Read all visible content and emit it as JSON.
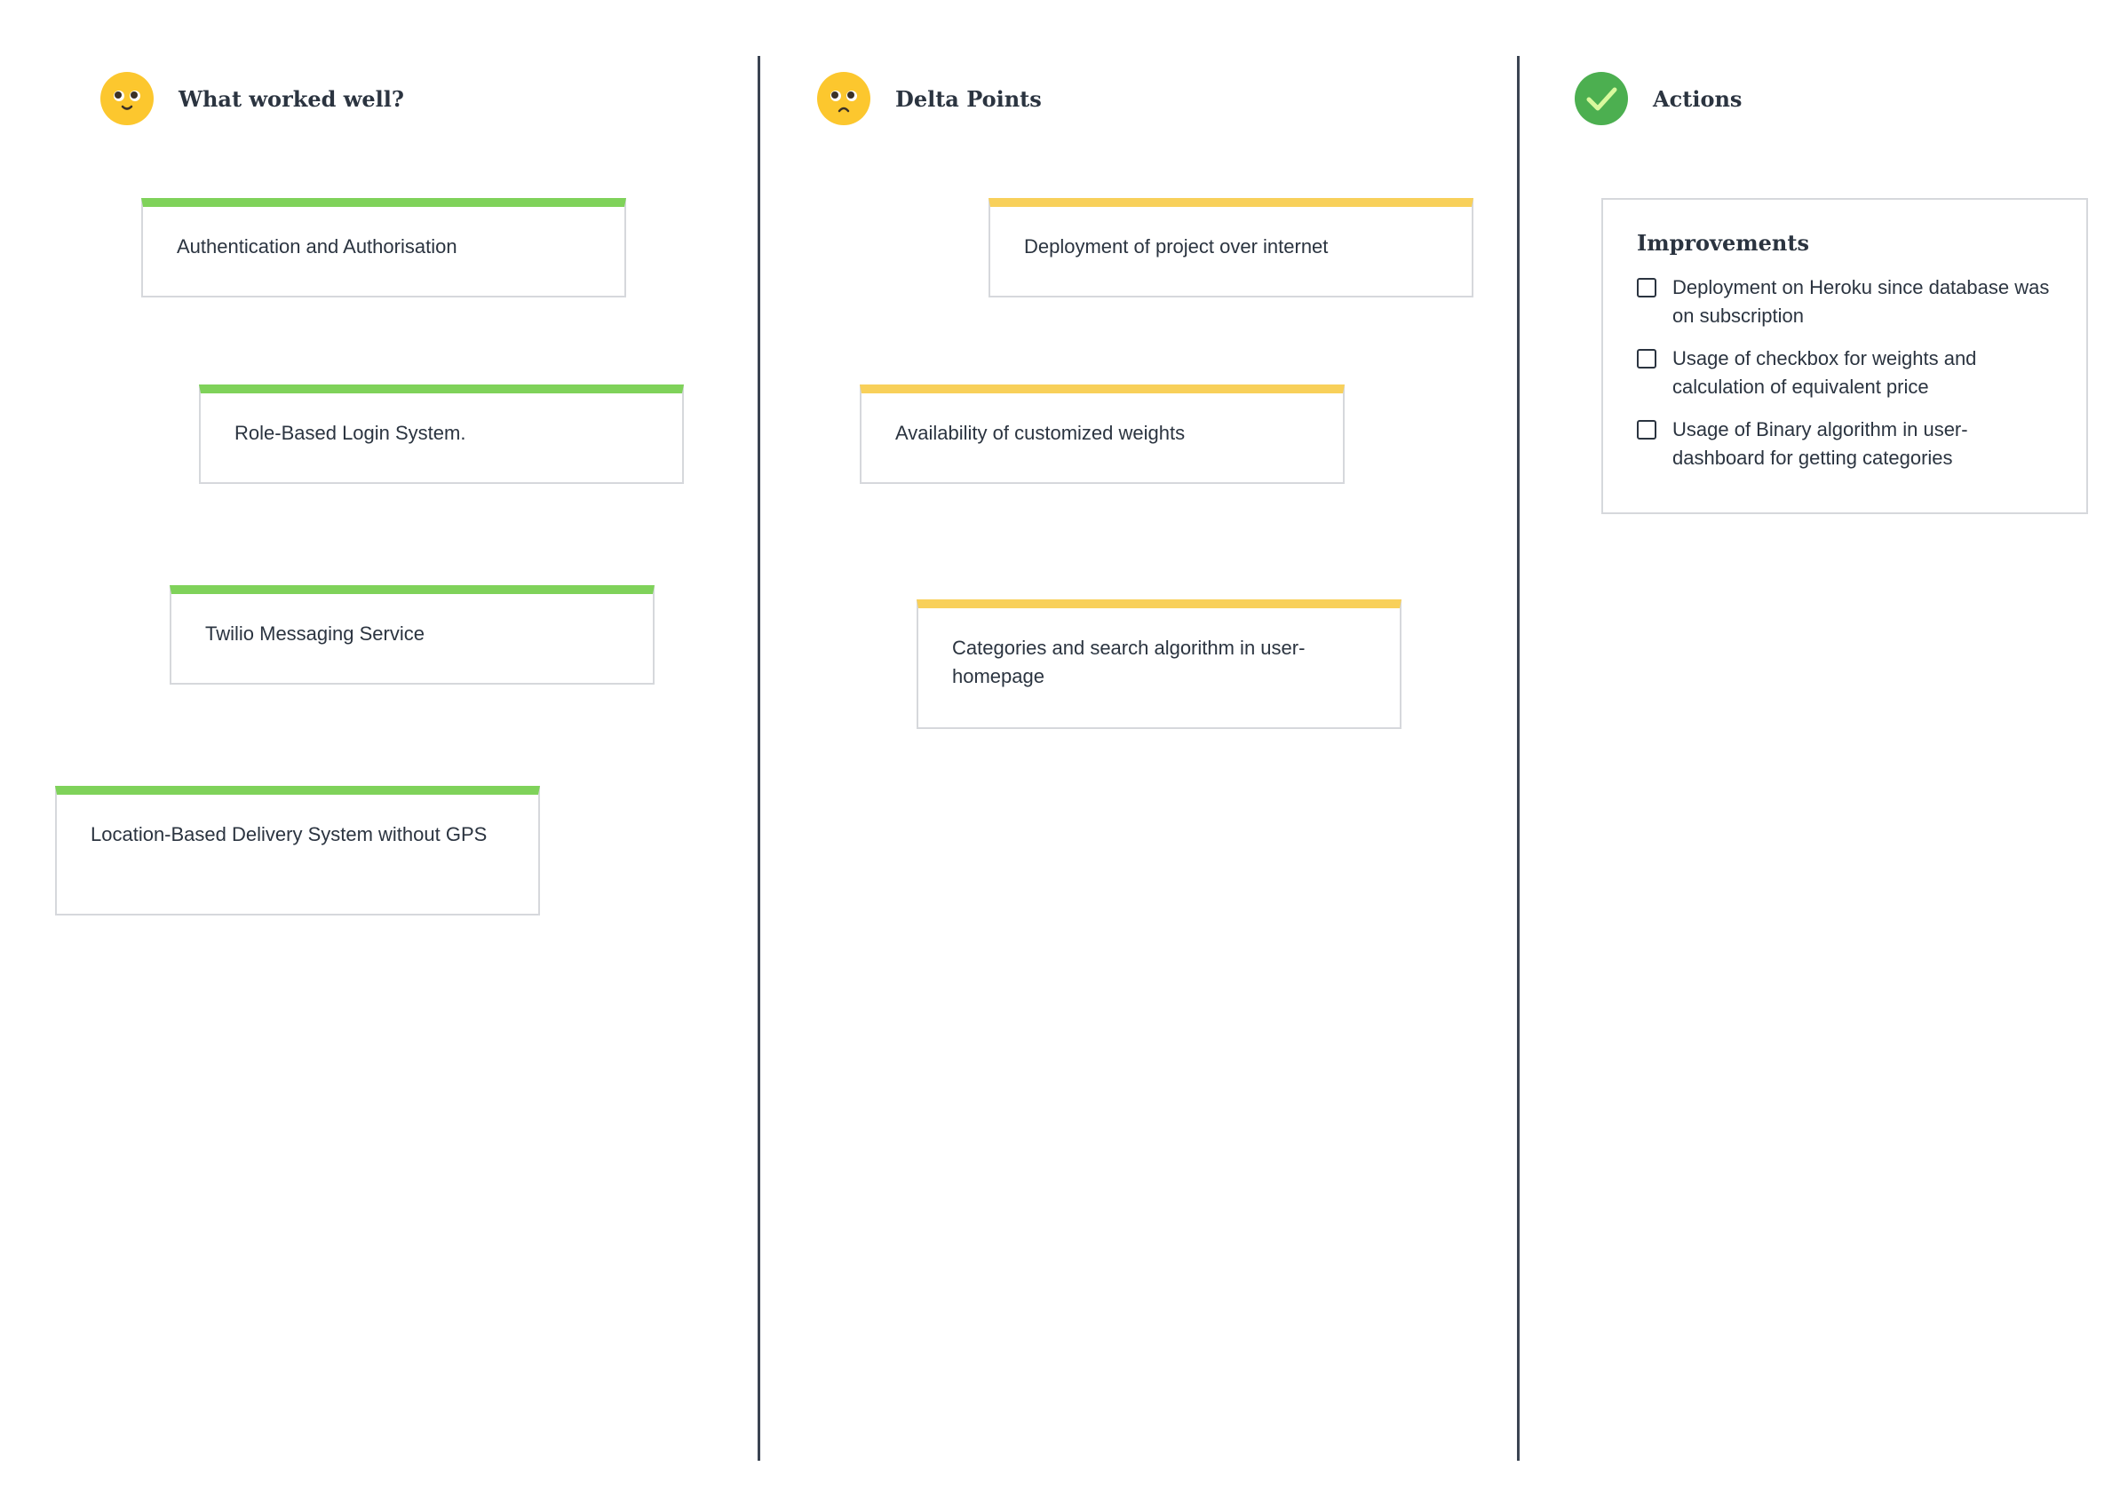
{
  "columns": [
    {
      "title": "What worked well?",
      "icon": "smiling-face-icon",
      "cards": [
        "Authentication and Authorisation",
        "Role-Based Login System.",
        "Twilio Messaging Service",
        "Location-Based Delivery System without GPS"
      ]
    },
    {
      "title": "Delta Points",
      "icon": "frowning-face-icon",
      "cards": [
        "Deployment of project over internet",
        "Availability of customized weights",
        "Categories and search algorithm in user-homepage"
      ]
    },
    {
      "title": "Actions",
      "icon": "checkmark-icon",
      "panel": {
        "title": "Improvements",
        "items": [
          {
            "label": "Deployment on Heroku since database was on subscription",
            "checked": false
          },
          {
            "label": "Usage of checkbox for weights and calculation of equivalent price",
            "checked": false
          },
          {
            "label": "Usage of Binary algorithm in user-dashboard for getting categories",
            "checked": false
          }
        ]
      }
    }
  ],
  "colors": {
    "good_accent": "#7fd25a",
    "delta_accent": "#f8d05a",
    "action_accent": "#4caf50",
    "emoji_yellow": "#fcc72e",
    "divider": "#3b4452",
    "text": "#2b3440"
  }
}
